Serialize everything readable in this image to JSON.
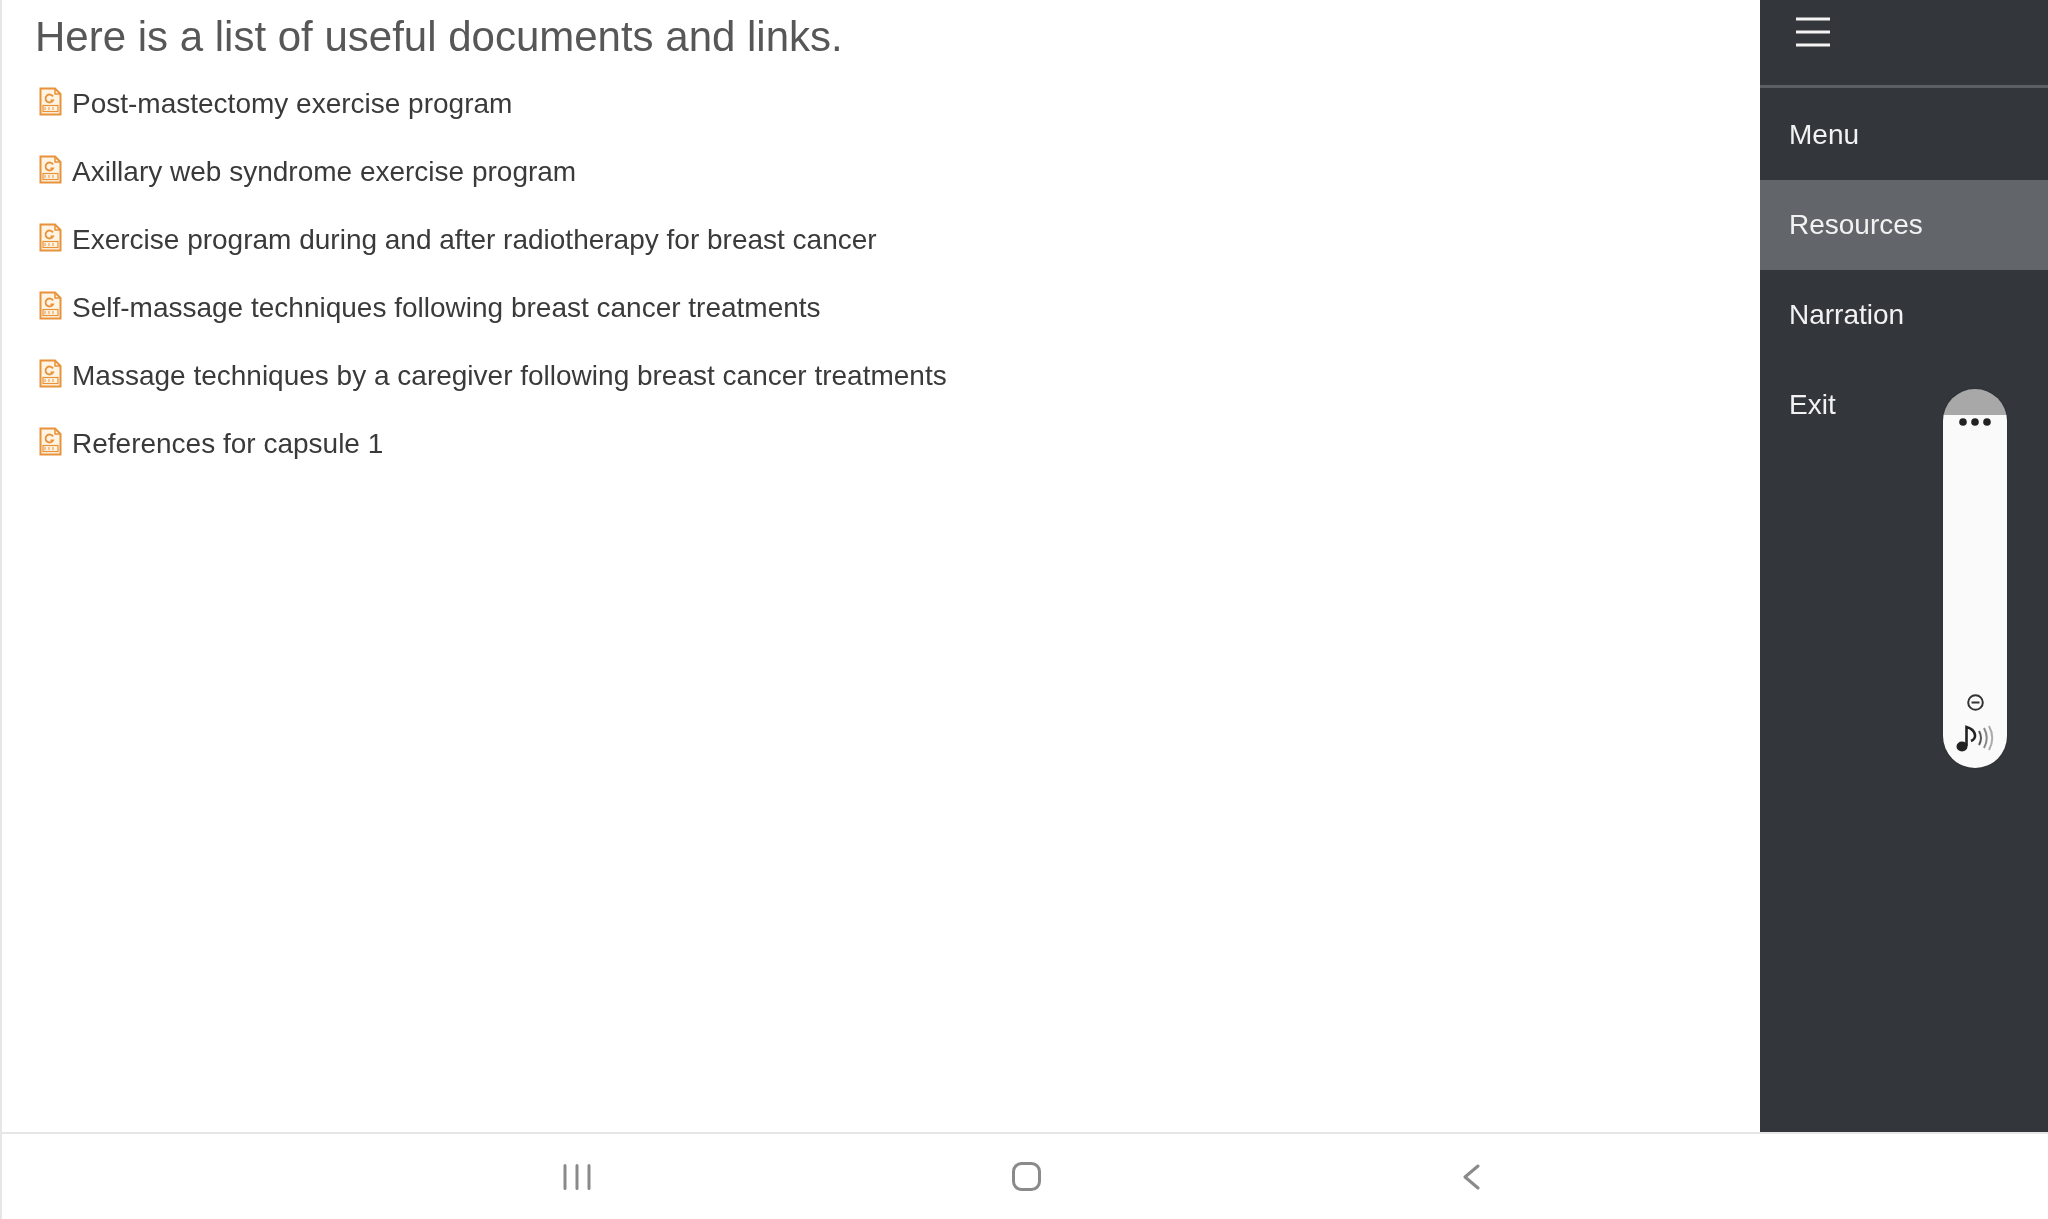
{
  "heading": "Here is a list of useful documents and links.",
  "documents": [
    {
      "title": "Post-mastectomy exercise program"
    },
    {
      "title": "Axillary web syndrome exercise program"
    },
    {
      "title": "Exercise program during and after radiotherapy for breast cancer"
    },
    {
      "title": "Self-massage techniques following breast cancer treatments"
    },
    {
      "title": "Massage techniques by a caregiver following breast cancer treatments"
    },
    {
      "title": "References for capsule 1"
    }
  ],
  "sidebar": {
    "items": [
      {
        "label": "Menu",
        "selected": false
      },
      {
        "label": "Resources",
        "selected": true
      },
      {
        "label": "Narration",
        "selected": false
      },
      {
        "label": "Exit",
        "selected": false
      }
    ]
  }
}
